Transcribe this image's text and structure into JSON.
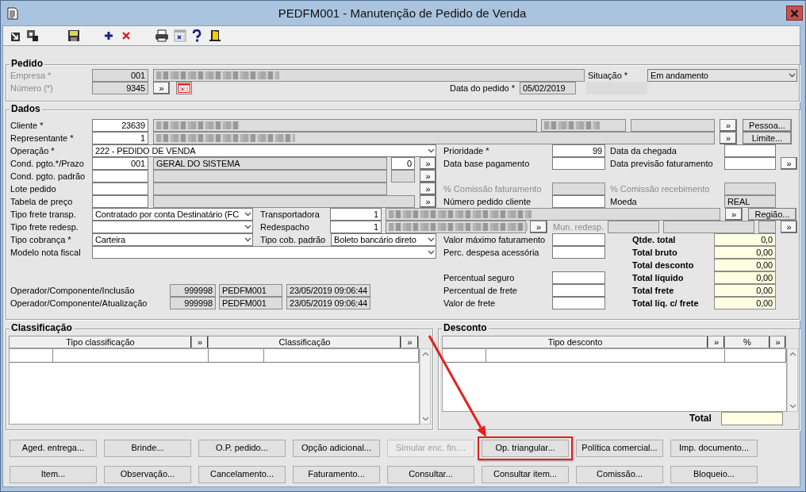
{
  "window": {
    "title": "PEDFM001 - Manutenção de Pedido de Venda"
  },
  "pedido": {
    "title": "Pedido",
    "lines": [
      {
        "items": [
          {
            "kind": "dim-label",
            "text": "Empresa *"
          },
          {
            "kind": "readonly-num",
            "value": "001"
          },
          {
            "kind": "redacted"
          },
          {
            "kind": "label",
            "text": "Situação *"
          },
          {
            "kind": "readonly-select",
            "value": "Em andamento"
          }
        ]
      },
      {
        "items": [
          {
            "kind": "dim-label",
            "text": "Número (*)"
          },
          {
            "kind": "readonly-num",
            "value": "9345"
          },
          {
            "kind": "more",
            "text": "»"
          },
          {
            "kind": "calendar"
          },
          {
            "kind": "label",
            "text": "Data do pedido *"
          },
          {
            "kind": "readonly",
            "value": "05/02/2019"
          },
          {
            "kind": "blank"
          }
        ]
      }
    ]
  },
  "dados": {
    "title": "Dados",
    "lines": [
      {
        "items": [
          {
            "kind": "label",
            "text": "Cliente *"
          },
          {
            "kind": "num",
            "value": "23639"
          },
          {
            "kind": "redacted"
          },
          {
            "kind": "redacted"
          },
          {
            "kind": "readonly"
          },
          {
            "kind": "more",
            "text": "»"
          },
          {
            "kind": "button",
            "text": "Pessoa..."
          }
        ]
      },
      {
        "items": [
          {
            "kind": "label",
            "text": "Representante *"
          },
          {
            "kind": "num",
            "value": "1"
          },
          {
            "kind": "redacted"
          },
          {
            "kind": "more",
            "text": "»"
          },
          {
            "kind": "button",
            "text": "Limite..."
          }
        ]
      },
      {
        "items": [
          {
            "kind": "label",
            "text": "Operação *"
          },
          {
            "kind": "select",
            "value": "222 - PEDIDO DE VENDA"
          },
          {
            "kind": "label",
            "text": "Prioridade *"
          },
          {
            "kind": "num",
            "value": "99"
          },
          {
            "kind": "label",
            "text": "Data da chegada"
          },
          {
            "kind": "input"
          }
        ]
      },
      {
        "items": [
          {
            "kind": "label",
            "text": "Cond. pgto.*/Prazo"
          },
          {
            "kind": "num",
            "value": "001"
          },
          {
            "kind": "readonly",
            "value": "GERAL DO SISTEMA"
          },
          {
            "kind": "num",
            "value": "0"
          },
          {
            "kind": "more",
            "text": "»"
          },
          {
            "kind": "label",
            "text": "Data base pagamento"
          },
          {
            "kind": "input"
          },
          {
            "kind": "label",
            "text": "Data previsão faturamento"
          },
          {
            "kind": "input"
          },
          {
            "kind": "more",
            "text": "»"
          }
        ]
      },
      {
        "items": [
          {
            "kind": "label",
            "text": "Cond. pgto. padrão"
          },
          {
            "kind": "input"
          },
          {
            "kind": "readonly"
          },
          {
            "kind": "readonly"
          },
          {
            "kind": "more",
            "text": "»"
          }
        ]
      },
      {
        "items": [
          {
            "kind": "label",
            "text": "Lote pedido"
          },
          {
            "kind": "input"
          },
          {
            "kind": "readonly"
          },
          {
            "kind": "more",
            "text": "»"
          },
          {
            "kind": "dim-label",
            "text": "% Comissão faturamento"
          },
          {
            "kind": "readonly"
          },
          {
            "kind": "dim-label",
            "text": "% Comissão recebimento"
          },
          {
            "kind": "readonly"
          }
        ]
      },
      {
        "items": [
          {
            "kind": "label",
            "text": "Tabela de preço"
          },
          {
            "kind": "input"
          },
          {
            "kind": "readonly"
          },
          {
            "kind": "more",
            "text": "»"
          },
          {
            "kind": "label",
            "text": "Número pedido cliente"
          },
          {
            "kind": "input"
          },
          {
            "kind": "label",
            "text": "Moeda"
          },
          {
            "kind": "readonly",
            "value": "REAL"
          }
        ]
      },
      {
        "items": [
          {
            "kind": "label",
            "text": "Tipo frete transp."
          },
          {
            "kind": "select",
            "value": "Contratado por conta Destinatário (FC"
          },
          {
            "kind": "label",
            "text": "Transportadora"
          },
          {
            "kind": "num",
            "value": "1"
          },
          {
            "kind": "redacted"
          },
          {
            "kind": "more",
            "text": "»"
          },
          {
            "kind": "button",
            "text": "Região..."
          }
        ]
      },
      {
        "items": [
          {
            "kind": "label",
            "text": "Tipo frete redesp."
          },
          {
            "kind": "select"
          },
          {
            "kind": "label",
            "text": "Redespacho"
          },
          {
            "kind": "num",
            "value": "1"
          },
          {
            "kind": "redacted"
          },
          {
            "kind": "more",
            "text": "»"
          },
          {
            "kind": "dim-label",
            "text": "Mun. redesp."
          },
          {
            "kind": "readonly"
          },
          {
            "kind": "readonly"
          },
          {
            "kind": "readonly"
          },
          {
            "kind": "more",
            "text": "»"
          }
        ]
      },
      {
        "items": [
          {
            "kind": "label",
            "text": "Tipo cobrança *"
          },
          {
            "kind": "select",
            "value": "Carteira"
          },
          {
            "kind": "label",
            "text": "Tipo cob. padrão"
          },
          {
            "kind": "select",
            "value": "Boleto bancário direto"
          },
          {
            "kind": "label",
            "text": "Valor máximo faturamento"
          },
          {
            "kind": "input"
          },
          {
            "kind": "bold-label",
            "text": "Qtde. total"
          },
          {
            "kind": "total",
            "value": "0,0"
          }
        ]
      },
      {
        "items": [
          {
            "kind": "label",
            "text": "Modelo nota fiscal"
          },
          {
            "kind": "select"
          },
          {
            "kind": "label",
            "text": "Perc. despesa acessória"
          },
          {
            "kind": "input"
          },
          {
            "kind": "bold-label",
            "text": "Total bruto"
          },
          {
            "kind": "total",
            "value": "0,00"
          }
        ]
      },
      {
        "items": [
          {
            "kind": "bold-label",
            "text": "Total desconto"
          },
          {
            "kind": "total",
            "value": "0,00"
          }
        ]
      },
      {
        "items": [
          {
            "kind": "label",
            "text": "Percentual seguro"
          },
          {
            "kind": "input"
          },
          {
            "kind": "bold-label",
            "text": "Total líquido"
          },
          {
            "kind": "total",
            "value": "0,00"
          }
        ]
      },
      {
        "items": [
          {
            "kind": "label",
            "text": "Operador/Componente/Inclusão"
          },
          {
            "kind": "readonly-num",
            "value": "999998"
          },
          {
            "kind": "readonly",
            "value": "PEDFM001"
          },
          {
            "kind": "readonly",
            "value": "23/05/2019 09:06:44"
          },
          {
            "kind": "label",
            "text": "Percentual de frete"
          },
          {
            "kind": "input"
          },
          {
            "kind": "bold-label",
            "text": "Total frete"
          },
          {
            "kind": "total",
            "value": "0,00"
          }
        ]
      },
      {
        "items": [
          {
            "kind": "label",
            "text": "Operador/Componente/Atualização"
          },
          {
            "kind": "readonly-num",
            "value": "999998"
          },
          {
            "kind": "readonly",
            "value": "PEDFM001"
          },
          {
            "kind": "readonly",
            "value": "23/05/2019 09:06:44"
          },
          {
            "kind": "label",
            "text": "Valor de frete"
          },
          {
            "kind": "input"
          },
          {
            "kind": "bold-label",
            "text": "Total líq. c/ frete"
          },
          {
            "kind": "total",
            "value": "0,00"
          }
        ]
      }
    ]
  },
  "classificacao": {
    "title": "Classificação",
    "columns": [
      "Tipo classificação",
      "»",
      "Classificação",
      "»"
    ]
  },
  "desconto": {
    "title": "Desconto",
    "columns": [
      "Tipo desconto",
      "»",
      "%",
      "»"
    ],
    "total_label": "Total"
  },
  "buttons": [
    {
      "label": "Aged. entrega...",
      "disabled": false,
      "highlighted": false
    },
    {
      "label": "Brinde...",
      "disabled": false,
      "highlighted": false
    },
    {
      "label": "O.P. pedido...",
      "disabled": false,
      "highlighted": false
    },
    {
      "label": "Opção adicional...",
      "disabled": false,
      "highlighted": false
    },
    {
      "label": "Simular enc. fin....",
      "disabled": true,
      "highlighted": false
    },
    {
      "label": "Op. triangular...",
      "disabled": false,
      "highlighted": true
    },
    {
      "label": "Política comercial...",
      "disabled": false,
      "highlighted": false
    },
    {
      "label": "Imp. documento...",
      "disabled": false,
      "highlighted": false
    },
    {
      "label": "Item...",
      "disabled": false,
      "highlighted": false
    },
    {
      "label": "Observação...",
      "disabled": false,
      "highlighted": false
    },
    {
      "label": "Cancelamento...",
      "disabled": false,
      "highlighted": false
    },
    {
      "label": "Faturamento...",
      "disabled": false,
      "highlighted": false
    },
    {
      "label": "Consultar...",
      "disabled": false,
      "highlighted": false
    },
    {
      "label": "Consultar item...",
      "disabled": false,
      "highlighted": false
    },
    {
      "label": "Comissão...",
      "disabled": false,
      "highlighted": false
    },
    {
      "label": "Bloqueio...",
      "disabled": false,
      "highlighted": false
    }
  ]
}
